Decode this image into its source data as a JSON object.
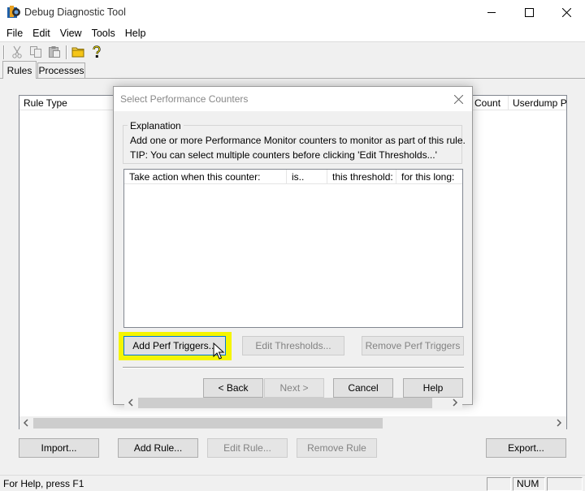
{
  "window": {
    "title": "Debug Diagnostic Tool",
    "icon": "debugdiag-app-icon",
    "caption_buttons": [
      "minimize-icon",
      "maximize-icon",
      "close-icon"
    ]
  },
  "menu": [
    "File",
    "Edit",
    "View",
    "Tools",
    "Help"
  ],
  "toolbar": [
    "cut-icon",
    "copy-icon",
    "paste-icon",
    "open-folder-icon",
    "help-icon"
  ],
  "tabs": [
    {
      "label": "Rules",
      "selected": true
    },
    {
      "label": "Processes",
      "selected": false
    }
  ],
  "rules_list": {
    "columns": [
      "Rule Type",
      "Count",
      "Userdump Pat"
    ]
  },
  "main_buttons": {
    "import": "Import...",
    "add_rule": "Add Rule...",
    "edit_rule": "Edit Rule...",
    "remove_rule": "Remove Rule",
    "export": "Export..."
  },
  "status": {
    "help_text": "For Help, press F1",
    "num": "NUM"
  },
  "dialog": {
    "title": "Select Performance Counters",
    "explanation_title": "Explanation",
    "explanation_line1": "Add one or more Performance Monitor counters to monitor as part of this rule.",
    "explanation_line2": "TIP:  You can select multiple counters before clicking 'Edit Thresholds...'",
    "columns": [
      "Take action when this counter:",
      "is..",
      "this threshold:",
      "for this long:"
    ],
    "buttons": {
      "add_perf": "Add Perf Triggers...",
      "edit_thresholds": "Edit Thresholds...",
      "remove_perf": "Remove Perf Triggers",
      "back": "< Back",
      "next": "Next >",
      "cancel": "Cancel",
      "help": "Help"
    },
    "highlight_color": "#f5f500"
  }
}
